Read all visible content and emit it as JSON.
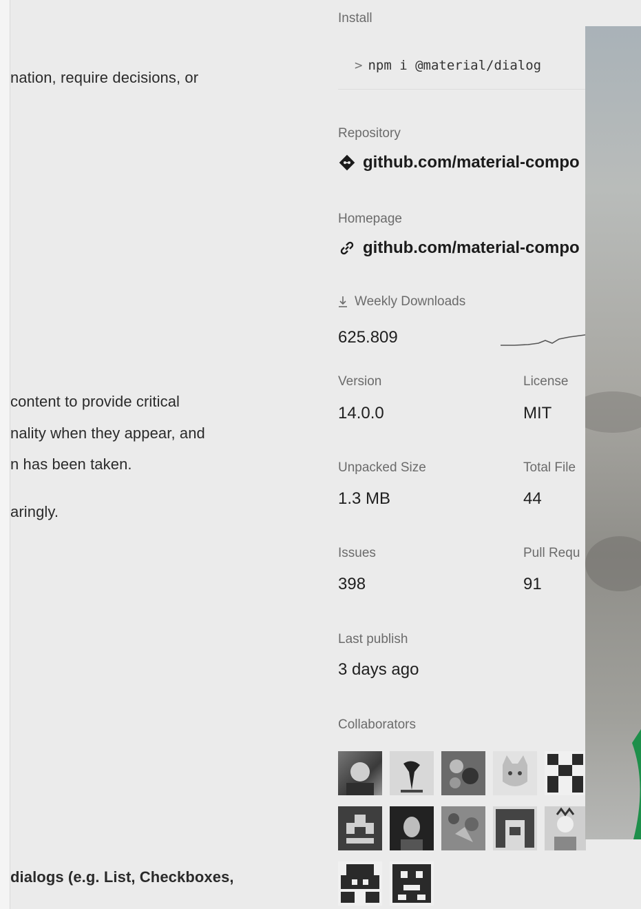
{
  "readme": {
    "line1": "nation, require decisions, or",
    "line2": "content to provide critical",
    "line3": "nality when they appear, and",
    "line4": "n has been taken.",
    "line5": "aringly.",
    "line6": "dialogs (e.g. List, Checkboxes,"
  },
  "sidebar": {
    "install_label": "Install",
    "install_cmd": "npm i @material/dialog",
    "install_prompt": ">",
    "repository_label": "Repository",
    "repository_link": "github.com/material-compo",
    "repository_icon": "git-icon",
    "homepage_label": "Homepage",
    "homepage_link": "github.com/material-compo",
    "homepage_icon": "link-icon",
    "weekly_downloads_label": "Weekly Downloads",
    "weekly_downloads_value": "625.809",
    "version_label": "Version",
    "version_value": "14.0.0",
    "license_label": "License",
    "license_value": "MIT",
    "unpacked_size_label": "Unpacked Size",
    "unpacked_size_value": "1.3 MB",
    "total_files_label": "Total File",
    "total_files_value": "44",
    "issues_label": "Issues",
    "issues_value": "398",
    "pull_requests_label": "Pull Requ",
    "pull_requests_value": "91",
    "last_publish_label": "Last publish",
    "last_publish_value": "3 days ago",
    "collaborators_label": "Collaborators"
  },
  "colors": {
    "background": "#ebebeb",
    "label": "#6b6b6b",
    "value": "#1f1f1f"
  }
}
